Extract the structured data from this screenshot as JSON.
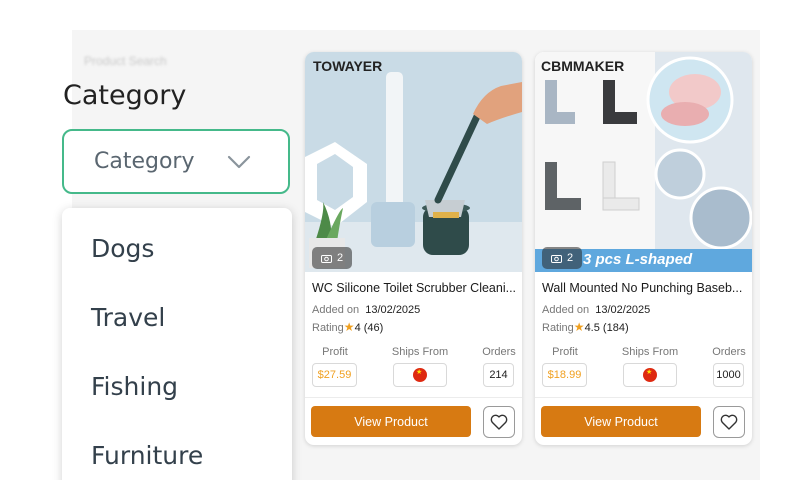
{
  "page": {
    "blurred_heading": "Product Search"
  },
  "category_panel": {
    "title": "Category",
    "select_value": "Category",
    "options": [
      "Dogs",
      "Travel",
      "Fishing",
      "Furniture"
    ]
  },
  "products": [
    {
      "brand": "TOWAYER",
      "photo_count": "2",
      "title": "WC Silicone Toilet Scrubber Cleani...",
      "added_label": "Added on",
      "added_date": "13/02/2025",
      "rating_label": "Rating",
      "rating": "4",
      "rating_count": "(46)",
      "profit_label": "Profit",
      "profit": "$27.59",
      "ships_label": "Ships From",
      "ships_from_icon": "china-flag-icon",
      "orders_label": "Orders",
      "orders": "214",
      "view_label": "View Product"
    },
    {
      "brand": "CBMMAKER",
      "photo_count": "2",
      "banner_text": "3 pcs  L-shaped",
      "title": "Wall Mounted No Punching Baseb...",
      "added_label": "Added on",
      "added_date": "13/02/2025",
      "rating_label": "Rating",
      "rating": "4.5",
      "rating_count": "(184)",
      "profit_label": "Profit",
      "profit": "$18.99",
      "ships_label": "Ships From",
      "ships_from_icon": "china-flag-icon",
      "orders_label": "Orders",
      "orders": "1000",
      "view_label": "View Product"
    }
  ],
  "colors": {
    "accent_green": "#45b98a",
    "button_orange": "#d77a12",
    "profit_orange": "#f0a020"
  }
}
